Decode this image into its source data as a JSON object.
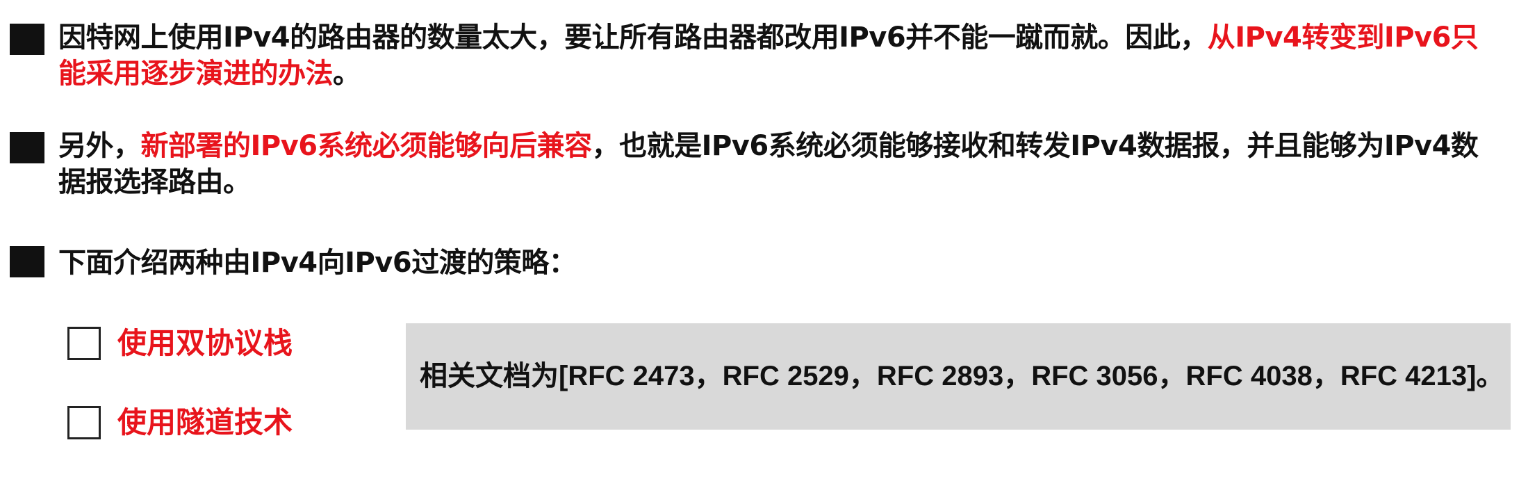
{
  "bullets": [
    {
      "text_1": "因特网上使用IPv4的路由器的数量太大，要让所有路由器都改用IPv6并不能一蹴而就。因此，",
      "highlight": "从IPv4转变到IPv6只能采用逐步演进的办法",
      "text_2": "。"
    },
    {
      "text_1": "另外，",
      "highlight": "新部署的IPv6系统必须能够向后兼容",
      "text_2": "，也就是IPv6系统必须能够接收和转发IPv4数据报，并且能够为IPv4数据报选择路由。"
    },
    {
      "text_1": "下面介绍两种由IPv4向IPv6过渡的策略："
    }
  ],
  "strategies": [
    {
      "label": "使用双协议栈"
    },
    {
      "label": "使用隧道技术"
    }
  ],
  "note": {
    "lead": "相关文档为",
    "refs": "[RFC 2473，RFC 2529，RFC 2893，RFC 3056，RFC 4038，RFC 4213]。"
  },
  "colors": {
    "highlight": "#e8141c",
    "text": "#111111",
    "note_background": "#d9d9d9"
  }
}
